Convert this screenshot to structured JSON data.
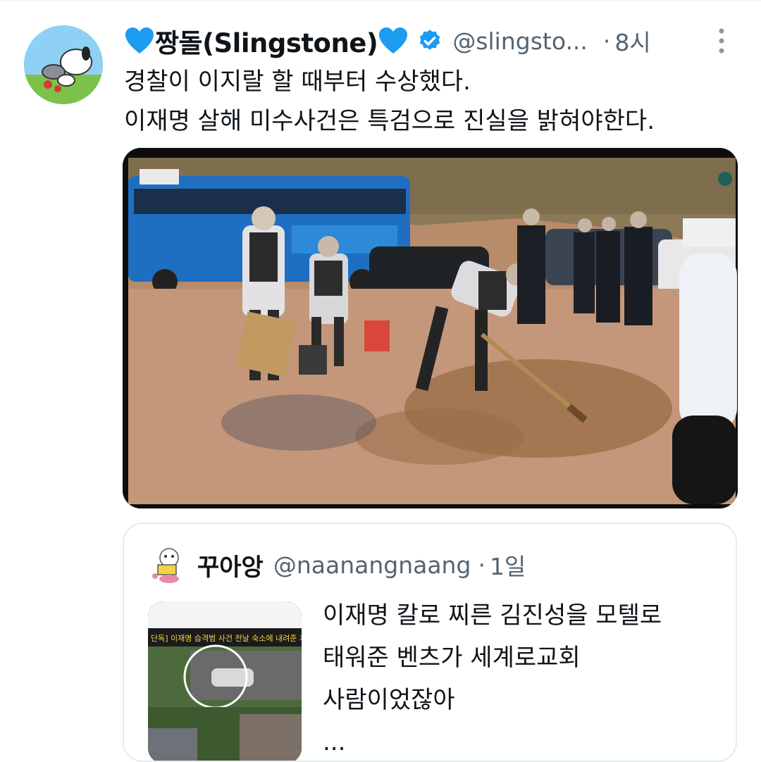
{
  "tweet": {
    "display_name": "짱돌(Slingstone)",
    "handle": "@slingsto...",
    "time": "8시",
    "text_lines": [
      "경찰이 이지랄 할 때부터 수상했다.",
      "이재명 살해 미수사건은 특검으로 진실을 밝혀야한다."
    ],
    "icons": {
      "heart": "blue-heart-icon",
      "verified": "verified-badge-icon",
      "more": "more-options-icon"
    },
    "colors": {
      "heart": "#1d9bf0",
      "verified": "#1d9bf0",
      "secondary_text": "#536471"
    }
  },
  "quoted_tweet": {
    "display_name": "꾸아앙",
    "handle": "@naanangnaang",
    "time": "1일",
    "text_lines": [
      "이재명 칼로 찌른 김진성을 모텔로",
      "태워준 벤츠가 세계로교회",
      "사람이었잖아",
      "..."
    ],
    "thumbnail_caption": "단독] 이재명 습격범 사건 전날 숙소에 내려준 차"
  },
  "separator": "·"
}
